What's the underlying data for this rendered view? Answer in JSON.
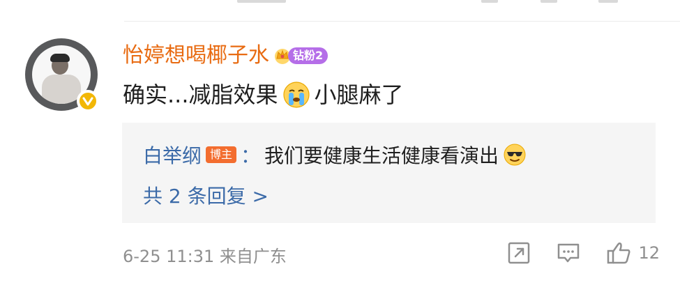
{
  "top": {
    "strip_color": "#d9d9d9"
  },
  "comment": {
    "username": "怡婷想喝椰子水",
    "fan_badge": "钻粉2",
    "text_before_emoji": "确实...减脂效果",
    "emoji_name": "crying-emoji",
    "text_after_emoji": "小腿麻了",
    "timestamp": "6-25 11:31",
    "source": "来自广东",
    "like_count": "12"
  },
  "reply": {
    "author": "白举纲",
    "author_badge": "博主",
    "separator": "：",
    "text": "我们要健康生活健康看演出",
    "emoji_name": "sunglasses-emoji",
    "view_replies": "共 2 条回复 >"
  },
  "colors": {
    "username": "#e86b12",
    "reply_author": "#3b6aa8",
    "meta": "#8f8f8f",
    "badge_blogger": "#f36d2f",
    "badge_fan": "#b56ee8",
    "verified": "#f2b705"
  }
}
